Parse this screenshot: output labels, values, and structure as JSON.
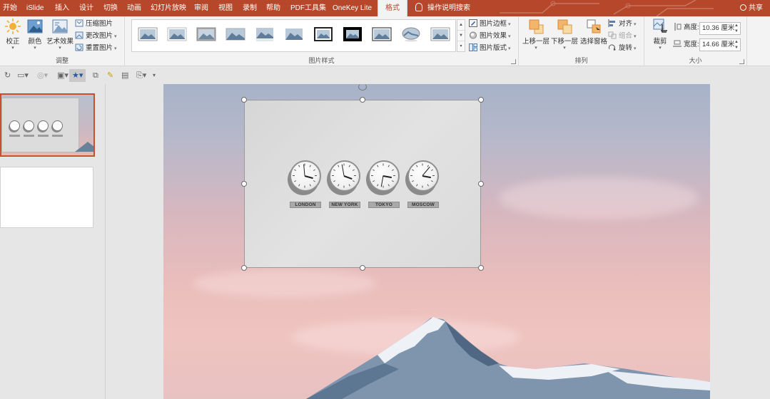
{
  "tabs": [
    "开始",
    "iSlide",
    "插入",
    "设计",
    "切换",
    "动画",
    "幻灯片放映",
    "审阅",
    "视图",
    "录制",
    "帮助",
    "PDF工具集",
    "OneKey Lite"
  ],
  "active_tab": "格式",
  "tell_me": "操作说明搜索",
  "share": "共享",
  "ribbon": {
    "adjust": {
      "label": "调整",
      "correct": "校正",
      "color": "颜色",
      "artistic": "艺术效果",
      "compress": "压缩图片",
      "change": "更改图片",
      "reset": "重置图片"
    },
    "styles": {
      "label": "图片样式",
      "border": "图片边框",
      "effects": "图片效果",
      "layout": "图片版式"
    },
    "arrange": {
      "label": "排列",
      "forward": "上移一层",
      "backward": "下移一层",
      "pane": "选择窗格",
      "align": "对齐",
      "group": "组合",
      "rotate": "旋转"
    },
    "size": {
      "label": "大小",
      "crop": "裁剪",
      "height_label": "高度:",
      "height": "10.36 厘米",
      "width_label": "宽度:",
      "width": "14.66 厘米"
    }
  },
  "clocks": [
    {
      "city": "LONDON",
      "hour_angle": 15,
      "minute_angle": -95
    },
    {
      "city": "NEW YORK",
      "hour_angle": 20,
      "minute_angle": -100
    },
    {
      "city": "TOKYO",
      "hour_angle": 10,
      "minute_angle": 100
    },
    {
      "city": "MOSCOW",
      "hour_angle": 10,
      "minute_angle": -50
    }
  ],
  "colors": {
    "accent": "#b7472a",
    "thumb_selected": "#c7512f"
  }
}
